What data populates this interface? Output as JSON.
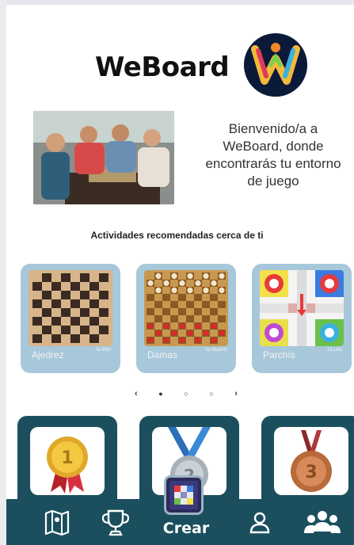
{
  "app": {
    "title": "WeBoard",
    "welcome": [
      "Bienvenido/a a",
      "WeBoard, donde",
      "encontrarás tu entorno",
      "de juego"
    ]
  },
  "section": {
    "title": "Actividades recomendadas cerca de ti"
  },
  "activities": [
    {
      "name": "Ajedrez",
      "small": "2a Mito",
      "icon": "chess-board-icon"
    },
    {
      "name": "Damas",
      "small": "3a Madrid",
      "icon": "checkers-board-icon"
    },
    {
      "name": "Parchís",
      "small": "2a Lilla",
      "icon": "parchis-board-icon"
    }
  ],
  "carousel": {
    "prev": "‹",
    "next": "›",
    "active_index": 0,
    "count": 3
  },
  "medals": [
    {
      "icon": "gold-medal-icon",
      "place": "1"
    },
    {
      "icon": "silver-medal-icon",
      "place": "2"
    },
    {
      "icon": "bronze-medal-icon",
      "place": "3"
    }
  ],
  "nav": {
    "items": [
      {
        "icon": "map-icon"
      },
      {
        "icon": "trophy-icon"
      },
      {
        "label": "Crear",
        "icon": "board-game-icon"
      },
      {
        "icon": "profile-icon"
      },
      {
        "icon": "group-icon"
      }
    ]
  },
  "colors": {
    "card_bg": "#a7c8da",
    "nav_bg": "#1b4f5e",
    "text": "#222222"
  }
}
